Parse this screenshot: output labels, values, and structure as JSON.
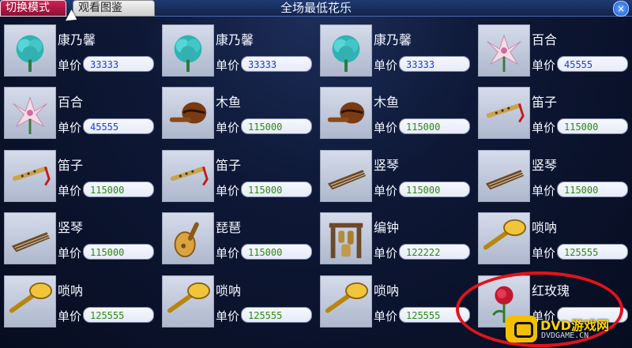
{
  "header": {
    "title": "全场最低花乐",
    "tabs": [
      {
        "label": "切换模式"
      },
      {
        "label": "观看图鉴"
      }
    ],
    "close_label": "×"
  },
  "items": [
    {
      "name": "康乃馨",
      "price_label": "单价",
      "price": "33333",
      "icon": "carnation-icon"
    },
    {
      "name": "康乃馨",
      "price_label": "单价",
      "price": "33333",
      "icon": "carnation-icon"
    },
    {
      "name": "康乃馨",
      "price_label": "单价",
      "price": "33333",
      "icon": "carnation-icon"
    },
    {
      "name": "百合",
      "price_label": "单价",
      "price": "45555",
      "icon": "lily-icon"
    },
    {
      "name": "百合",
      "price_label": "单价",
      "price": "45555",
      "icon": "lily-icon"
    },
    {
      "name": "木鱼",
      "price_label": "单价",
      "price": "115000",
      "icon": "wooden-fish-icon"
    },
    {
      "name": "木鱼",
      "price_label": "单价",
      "price": "115000",
      "icon": "wooden-fish-icon"
    },
    {
      "name": "笛子",
      "price_label": "单价",
      "price": "115000",
      "icon": "flute-icon"
    },
    {
      "name": "笛子",
      "price_label": "单价",
      "price": "115000",
      "icon": "flute-icon"
    },
    {
      "name": "笛子",
      "price_label": "单价",
      "price": "115000",
      "icon": "flute-icon"
    },
    {
      "name": "竖琴",
      "price_label": "单价",
      "price": "115000",
      "icon": "harp-icon"
    },
    {
      "name": "竖琴",
      "price_label": "单价",
      "price": "115000",
      "icon": "harp-icon"
    },
    {
      "name": "竖琴",
      "price_label": "单价",
      "price": "115000",
      "icon": "harp-icon"
    },
    {
      "name": "琵琶",
      "price_label": "单价",
      "price": "115000",
      "icon": "pipa-icon"
    },
    {
      "name": "编钟",
      "price_label": "单价",
      "price": "122222",
      "icon": "chime-bells-icon"
    },
    {
      "name": "唢呐",
      "price_label": "单价",
      "price": "125555",
      "icon": "suona-icon"
    },
    {
      "name": "唢呐",
      "price_label": "单价",
      "price": "125555",
      "icon": "suona-icon"
    },
    {
      "name": "唢呐",
      "price_label": "单价",
      "price": "125555",
      "icon": "suona-icon"
    },
    {
      "name": "唢呐",
      "price_label": "单价",
      "price": "125555",
      "icon": "suona-icon"
    },
    {
      "name": "红玫瑰",
      "price_label": "单价",
      "price": "",
      "icon": "red-rose-icon"
    }
  ],
  "watermark": {
    "text": "DVD游戏网",
    "sub": "DVDGAME.CN"
  },
  "colors": {
    "price_blue": "#1d3bd8",
    "price_green": "#2b8b11",
    "highlight_ring": "#e1131a"
  }
}
